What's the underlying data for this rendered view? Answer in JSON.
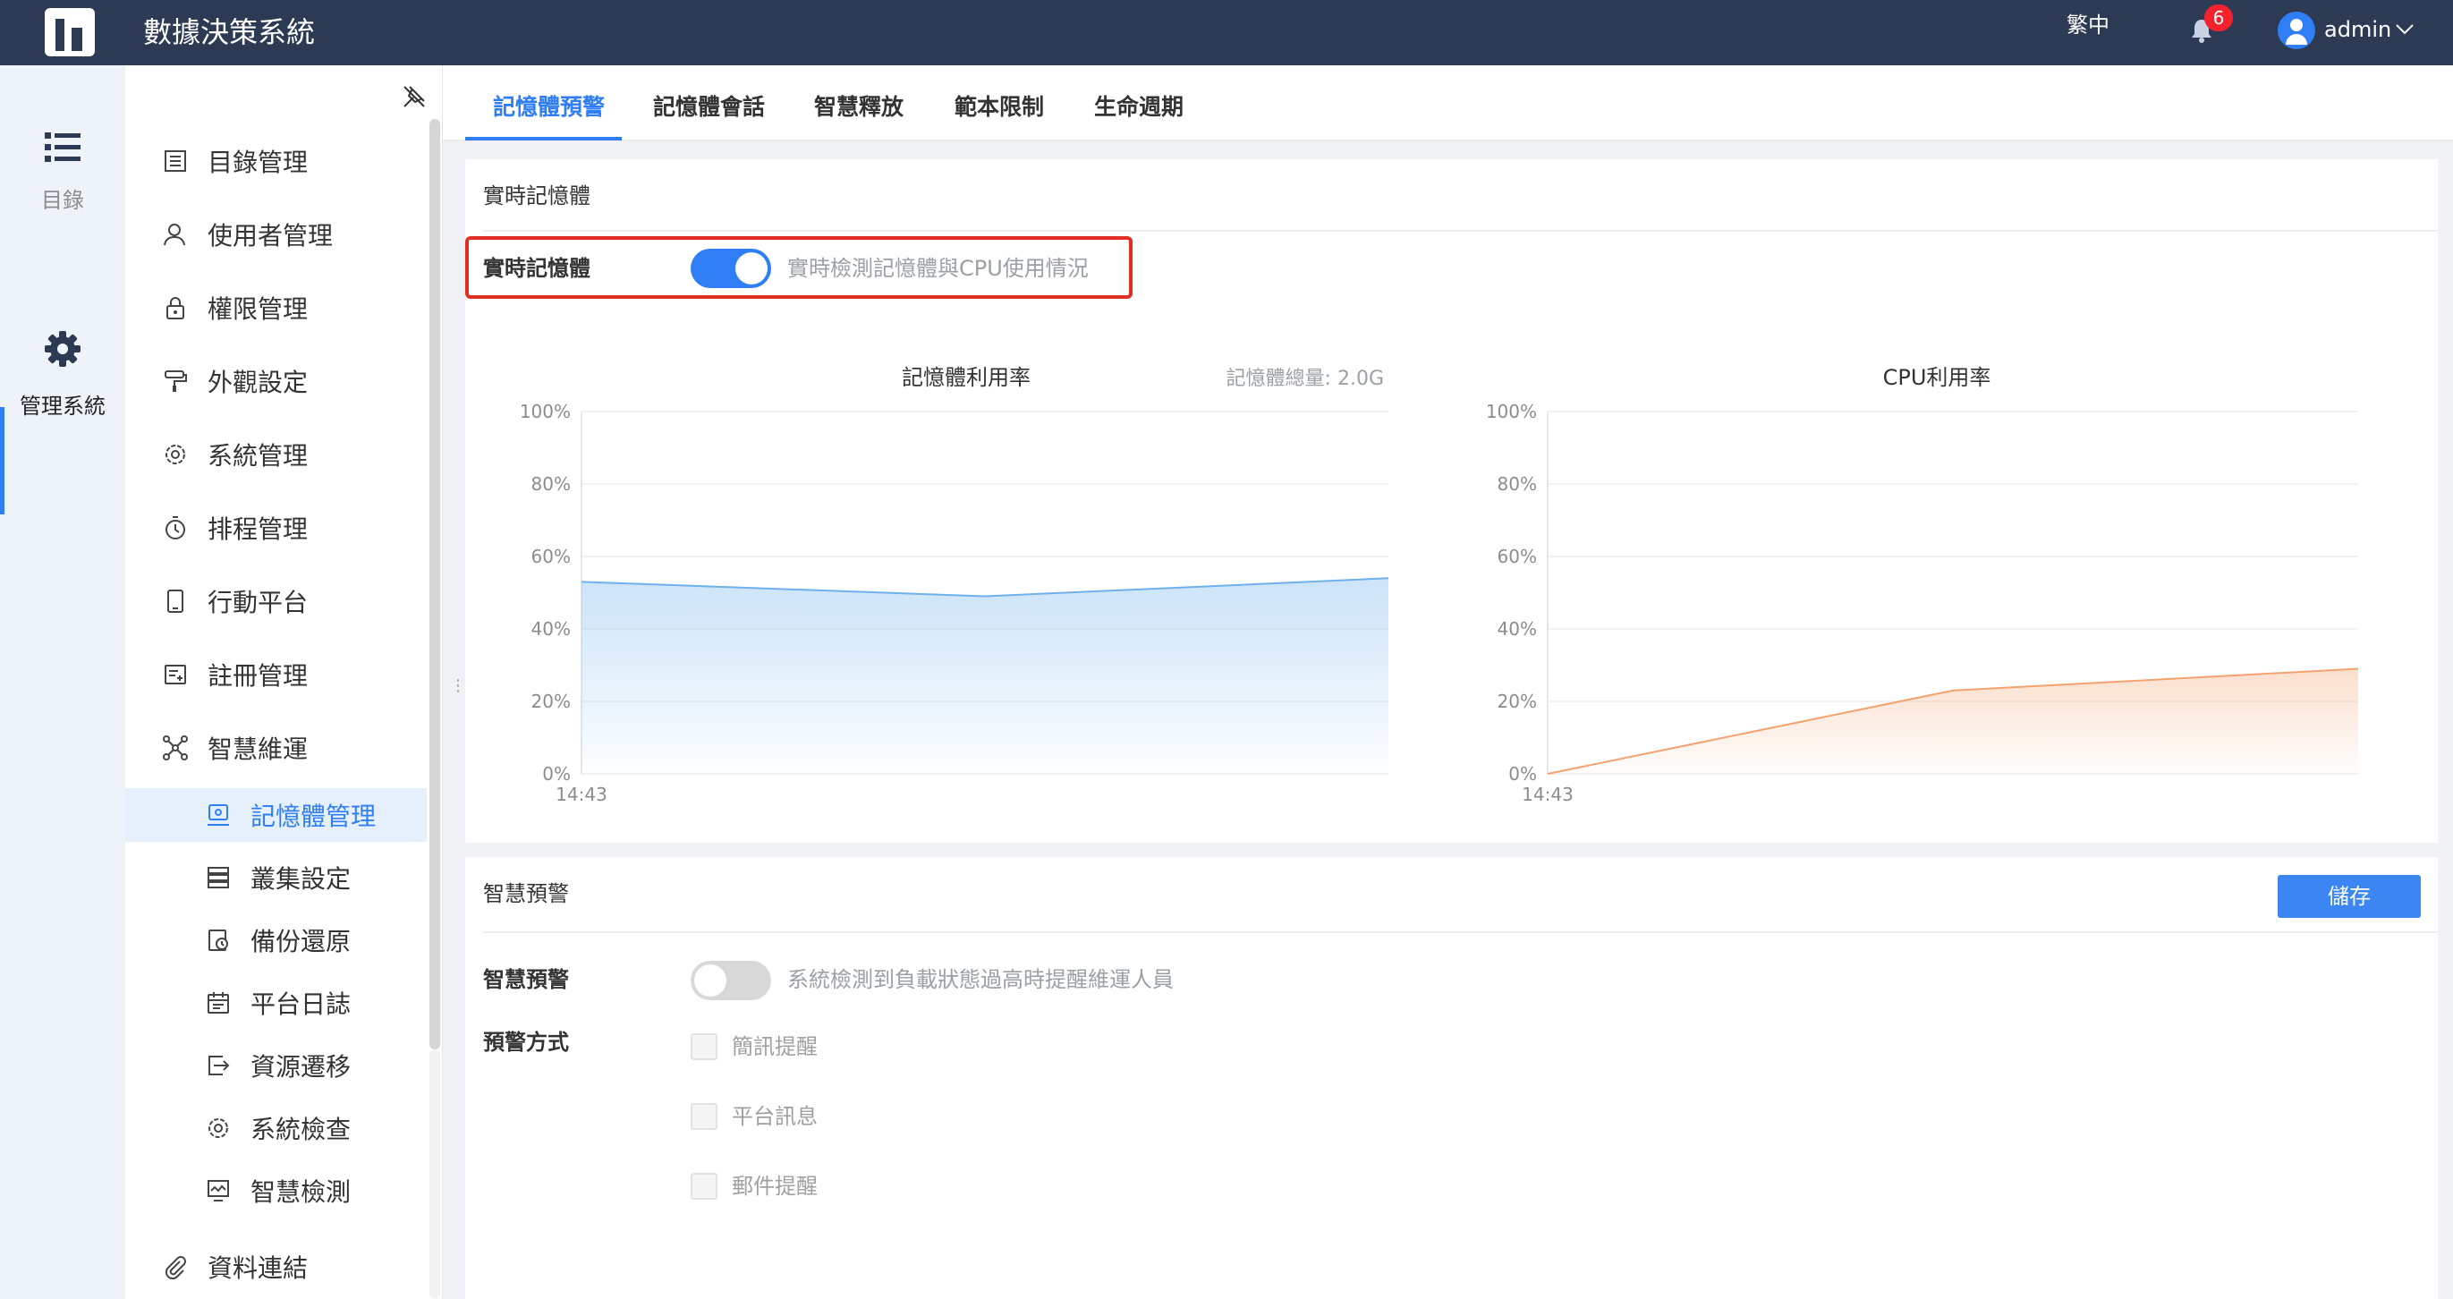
{
  "header": {
    "app_title": "數據決策系統",
    "language": "繁中",
    "notification_count": "6",
    "user_name": "admin"
  },
  "rail": {
    "items": [
      {
        "label": "目錄",
        "icon": "list-icon"
      },
      {
        "label": "管理系統",
        "icon": "gear-icon"
      }
    ]
  },
  "sidebar": {
    "items": [
      {
        "label": "目錄管理",
        "icon": "catalog-icon"
      },
      {
        "label": "使用者管理",
        "icon": "user-icon"
      },
      {
        "label": "權限管理",
        "icon": "lock-icon"
      },
      {
        "label": "外觀設定",
        "icon": "paint-roller-icon"
      },
      {
        "label": "系統管理",
        "icon": "settings-icon"
      },
      {
        "label": "排程管理",
        "icon": "timer-icon"
      },
      {
        "label": "行動平台",
        "icon": "mobile-icon"
      },
      {
        "label": "註冊管理",
        "icon": "register-icon"
      },
      {
        "label": "智慧維運",
        "icon": "network-icon"
      }
    ],
    "sub_items": [
      {
        "label": "記憶體管理",
        "icon": "memory-icon"
      },
      {
        "label": "叢集設定",
        "icon": "cluster-icon"
      },
      {
        "label": "備份還原",
        "icon": "backup-icon"
      },
      {
        "label": "平台日誌",
        "icon": "calendar-icon"
      },
      {
        "label": "資源遷移",
        "icon": "migrate-icon"
      },
      {
        "label": "系統檢查",
        "icon": "check-gear-icon"
      },
      {
        "label": "智慧檢測",
        "icon": "monitor-icon"
      }
    ],
    "bottom_item": {
      "label": "資料連結",
      "icon": "paperclip-icon"
    }
  },
  "tabs": [
    "記憶體預警",
    "記憶體會話",
    "智慧釋放",
    "範本限制",
    "生命週期"
  ],
  "realtime": {
    "section_title": "實時記憶體",
    "field_label": "實時記憶體",
    "toggle_on": true,
    "description": "實時檢測記憶體與CPU使用情況"
  },
  "colors": {
    "accent": "#2f7ef5",
    "memory_line": "#6fb1ec",
    "cpu_line": "#f4a26f",
    "header_bg": "#2d3a53"
  },
  "chart_data": [
    {
      "type": "area",
      "title": "記憶體利用率",
      "subtitle": "記憶體總量: 2.0G",
      "x_tick_labels": [
        "14:43"
      ],
      "y_tick_labels": [
        "100%",
        "80%",
        "60%",
        "40%",
        "20%",
        "0%"
      ],
      "ylim": [
        0,
        100
      ],
      "values": [
        53,
        49,
        54
      ],
      "grid": true
    },
    {
      "type": "area",
      "title": "CPU利用率",
      "x_tick_labels": [
        "14:43"
      ],
      "y_tick_labels": [
        "100%",
        "80%",
        "60%",
        "40%",
        "20%",
        "0%"
      ],
      "ylim": [
        0,
        100
      ],
      "values": [
        0,
        23,
        29
      ],
      "grid": true
    }
  ],
  "warning": {
    "section_title": "智慧預警",
    "save_label": "儲存",
    "field_label": "智慧預警",
    "toggle_on": false,
    "description": "系統檢測到負載狀態過高時提醒維運人員",
    "method_label": "預警方式",
    "methods": [
      "簡訊提醒",
      "平台訊息",
      "郵件提醒"
    ]
  }
}
